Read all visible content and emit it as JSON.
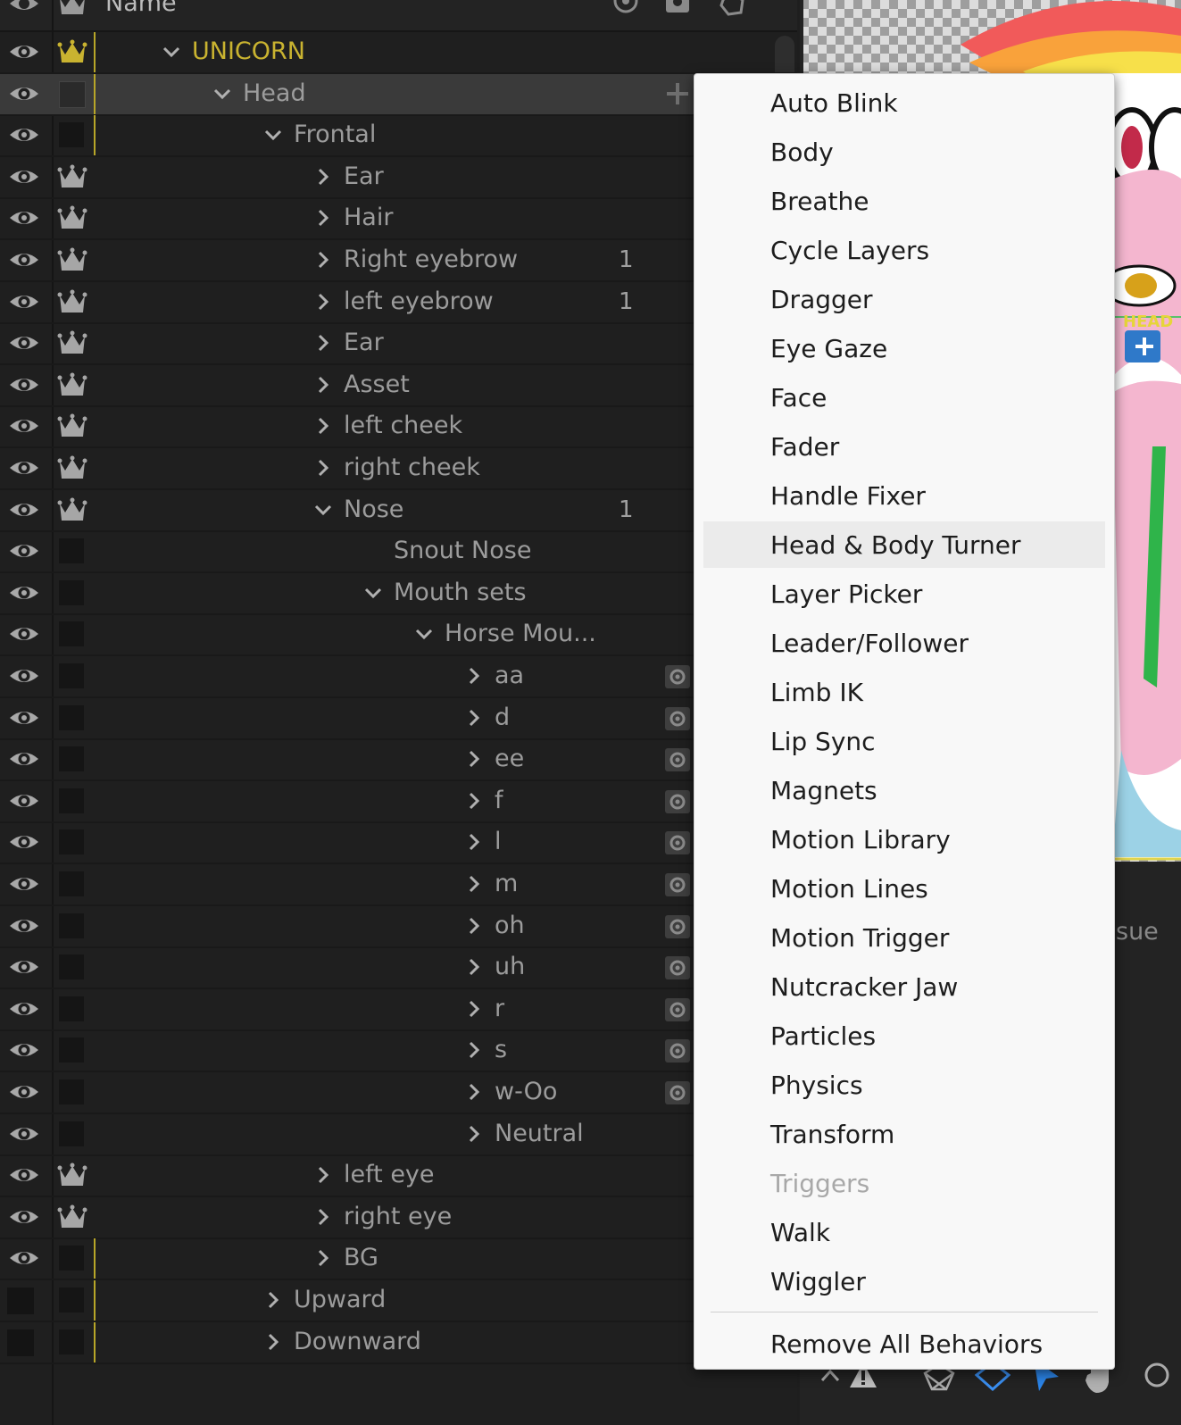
{
  "header": {
    "name_label": "Name"
  },
  "tree": {
    "rows": [
      {
        "label": "UNICORN",
        "depth": 0,
        "expander": "down",
        "tag": "crown-yellow",
        "bar": true,
        "num": "",
        "gear": false,
        "vis": true,
        "color": "#c9b330"
      },
      {
        "label": "Head",
        "depth": 1,
        "expander": "down",
        "tag": "box",
        "bar": true,
        "num": "",
        "gear": false,
        "vis": true,
        "selected": true,
        "plus": true
      },
      {
        "label": "Frontal",
        "depth": 2,
        "expander": "down",
        "tag": "box",
        "bar": true,
        "num": "",
        "gear": false,
        "vis": true
      },
      {
        "label": "Ear",
        "depth": 3,
        "expander": "right",
        "tag": "crown",
        "num": "",
        "gear": false,
        "vis": true
      },
      {
        "label": "Hair",
        "depth": 3,
        "expander": "right",
        "tag": "crown",
        "num": "",
        "gear": false,
        "vis": true
      },
      {
        "label": "Right eyebrow",
        "depth": 3,
        "expander": "right",
        "tag": "crown",
        "num": "1",
        "gear": false,
        "vis": true
      },
      {
        "label": "left eyebrow",
        "depth": 3,
        "expander": "right",
        "tag": "crown",
        "num": "1",
        "gear": false,
        "vis": true
      },
      {
        "label": "Ear",
        "depth": 3,
        "expander": "right",
        "tag": "crown",
        "num": "",
        "gear": false,
        "vis": true
      },
      {
        "label": "Asset",
        "depth": 3,
        "expander": "right",
        "tag": "crown",
        "num": "",
        "gear": false,
        "vis": true
      },
      {
        "label": "left cheek",
        "depth": 3,
        "expander": "right",
        "tag": "crown",
        "num": "",
        "gear": false,
        "vis": true
      },
      {
        "label": "right cheek",
        "depth": 3,
        "expander": "right",
        "tag": "crown",
        "num": "",
        "gear": false,
        "vis": true
      },
      {
        "label": "Nose",
        "depth": 3,
        "expander": "down",
        "tag": "crown",
        "num": "1",
        "gear": false,
        "vis": true
      },
      {
        "label": "Snout Nose",
        "depth": 4,
        "expander": "none",
        "tag": "box",
        "num": "",
        "gear": false,
        "vis": true
      },
      {
        "label": "Mouth sets",
        "depth": 4,
        "expander": "down",
        "tag": "box",
        "num": "",
        "gear": false,
        "vis": true
      },
      {
        "label": "Horse Mou...",
        "depth": 5,
        "expander": "down",
        "tag": "box",
        "num": "",
        "gear": false,
        "vis": true
      },
      {
        "label": "aa",
        "depth": 6,
        "expander": "right",
        "tag": "box",
        "num": "",
        "gear": true,
        "vis": true
      },
      {
        "label": "d",
        "depth": 6,
        "expander": "right",
        "tag": "box",
        "num": "",
        "gear": true,
        "vis": true
      },
      {
        "label": "ee",
        "depth": 6,
        "expander": "right",
        "tag": "box",
        "num": "",
        "gear": true,
        "vis": true
      },
      {
        "label": "f",
        "depth": 6,
        "expander": "right",
        "tag": "box",
        "num": "",
        "gear": true,
        "vis": true
      },
      {
        "label": "l",
        "depth": 6,
        "expander": "right",
        "tag": "box",
        "num": "",
        "gear": true,
        "vis": true
      },
      {
        "label": "m",
        "depth": 6,
        "expander": "right",
        "tag": "box",
        "num": "",
        "gear": true,
        "vis": true
      },
      {
        "label": "oh",
        "depth": 6,
        "expander": "right",
        "tag": "box",
        "num": "",
        "gear": true,
        "vis": true
      },
      {
        "label": "uh",
        "depth": 6,
        "expander": "right",
        "tag": "box",
        "num": "",
        "gear": true,
        "vis": true
      },
      {
        "label": "r",
        "depth": 6,
        "expander": "right",
        "tag": "box",
        "num": "",
        "gear": true,
        "vis": true
      },
      {
        "label": "s",
        "depth": 6,
        "expander": "right",
        "tag": "box",
        "num": "",
        "gear": true,
        "vis": true
      },
      {
        "label": "w-Oo",
        "depth": 6,
        "expander": "right",
        "tag": "box",
        "num": "",
        "gear": true,
        "vis": true
      },
      {
        "label": "Neutral",
        "depth": 6,
        "expander": "right",
        "tag": "box",
        "num": "",
        "gear": false,
        "vis": true
      },
      {
        "label": "left eye",
        "depth": 3,
        "expander": "right",
        "tag": "crown",
        "num": "",
        "gear": false,
        "vis": true
      },
      {
        "label": "right eye",
        "depth": 3,
        "expander": "right",
        "tag": "crown",
        "num": "",
        "gear": false,
        "vis": true
      },
      {
        "label": "BG",
        "depth": 3,
        "expander": "right",
        "tag": "box",
        "bar": true,
        "num": "",
        "gear": false,
        "vis": true
      },
      {
        "label": "Upward",
        "depth": 2,
        "expander": "right",
        "tag": "box",
        "bar": true,
        "num": "",
        "gear": false,
        "vis": false
      },
      {
        "label": "Downward",
        "depth": 2,
        "expander": "right",
        "tag": "box",
        "bar": true,
        "num": "",
        "gear": false,
        "vis": false
      }
    ]
  },
  "canvas": {
    "overlay_label": "HEAD",
    "side_text": "sue"
  },
  "menu": {
    "items": [
      {
        "label": "Auto Blink"
      },
      {
        "label": "Body"
      },
      {
        "label": "Breathe"
      },
      {
        "label": "Cycle Layers"
      },
      {
        "label": "Dragger"
      },
      {
        "label": "Eye Gaze"
      },
      {
        "label": "Face"
      },
      {
        "label": "Fader"
      },
      {
        "label": "Handle Fixer"
      },
      {
        "label": "Head & Body Turner",
        "highlighted": true
      },
      {
        "label": "Layer Picker"
      },
      {
        "label": "Leader/Follower"
      },
      {
        "label": "Limb IK"
      },
      {
        "label": "Lip Sync"
      },
      {
        "label": "Magnets"
      },
      {
        "label": "Motion Library"
      },
      {
        "label": "Motion Lines"
      },
      {
        "label": "Motion Trigger"
      },
      {
        "label": "Nutcracker Jaw"
      },
      {
        "label": "Particles"
      },
      {
        "label": "Physics"
      },
      {
        "label": "Transform"
      },
      {
        "label": "Triggers",
        "disabled": true
      },
      {
        "label": "Walk"
      },
      {
        "label": "Wiggler"
      }
    ],
    "remove_all_label": "Remove All Behaviors"
  },
  "colors": {
    "accent_yellow": "#c9b330",
    "panel_bg": "#1f1f1f",
    "menu_bg": "#f8f8f8",
    "menu_highlight": "#ebebeb",
    "canvas_pink": "#f4b6cf",
    "tool_blue": "#2b84e8"
  }
}
